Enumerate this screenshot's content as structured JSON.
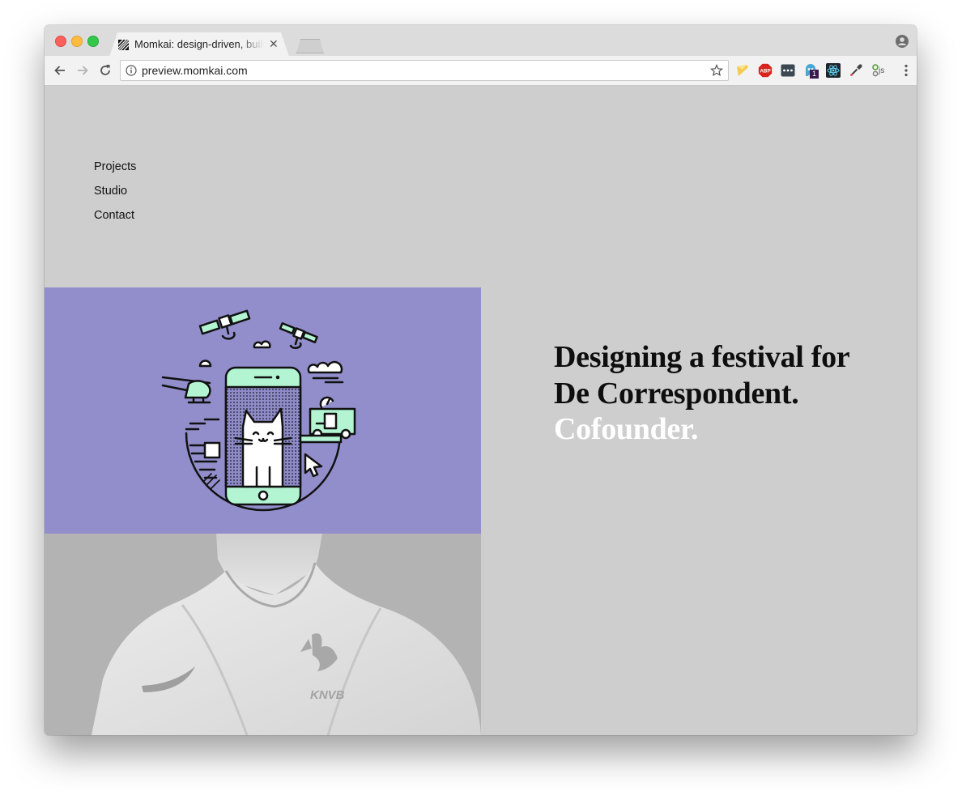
{
  "browser": {
    "tab_title": "Momkai: design-driven, building products",
    "url": "preview.momkai.com",
    "extension_badge": "1",
    "extension_label_js": "js",
    "extension_label_abp": "ABP"
  },
  "nav": {
    "items": [
      "Projects",
      "Studio",
      "Contact"
    ]
  },
  "feature": {
    "headline": "Designing a festival for De Correspondent.",
    "role": "Cofounder.",
    "jersey_brand": "KNVB"
  },
  "colors": {
    "page_bg": "#cecece",
    "illustration_bg": "#918ecb",
    "mint_accent": "#b3f5d3",
    "role_text": "#ffffff"
  }
}
